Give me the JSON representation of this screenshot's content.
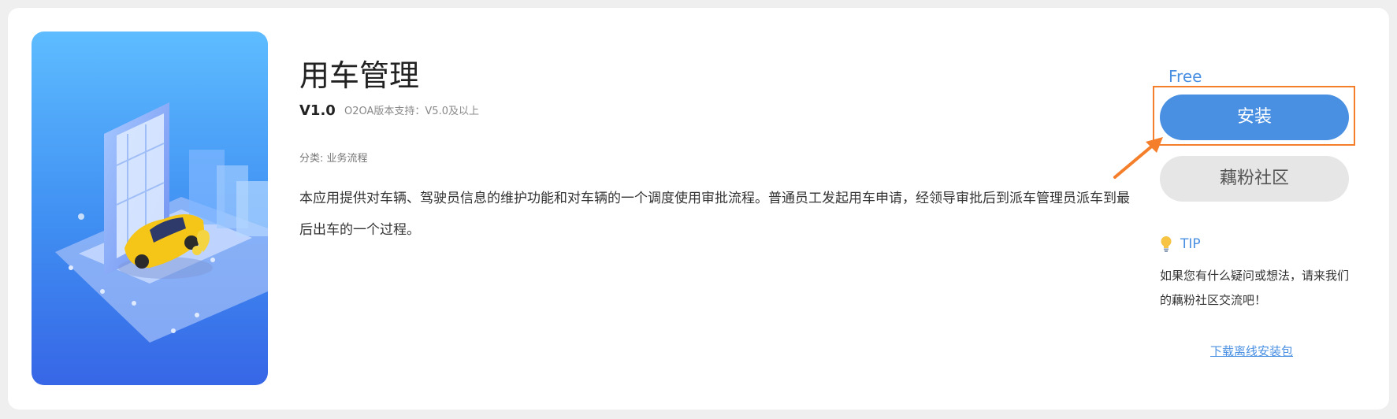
{
  "app": {
    "title": "用车管理",
    "version": "V1.0",
    "support": "O2OA版本支持：V5.0及以上",
    "category": "分类: 业务流程",
    "description": "本应用提供对车辆、驾驶员信息的维护功能和对车辆的一个调度使用审批流程。普通员工发起用车申请，经领导审批后到派车管理员派车到最后出车的一个过程。"
  },
  "sidebar": {
    "price": "Free",
    "install_label": "安装",
    "community_label": "藕粉社区",
    "tip_label": "TIP",
    "tip_text": "如果您有什么疑问或想法，请来我们的藕粉社区交流吧！",
    "download_label": "下载离线安装包"
  },
  "colors": {
    "accent": "#4a90e2",
    "highlight": "#f47e2a",
    "secondary_button": "#e6e6e6"
  },
  "icons": {
    "tip": "lightbulb-icon",
    "annotation": "arrow-icon"
  }
}
